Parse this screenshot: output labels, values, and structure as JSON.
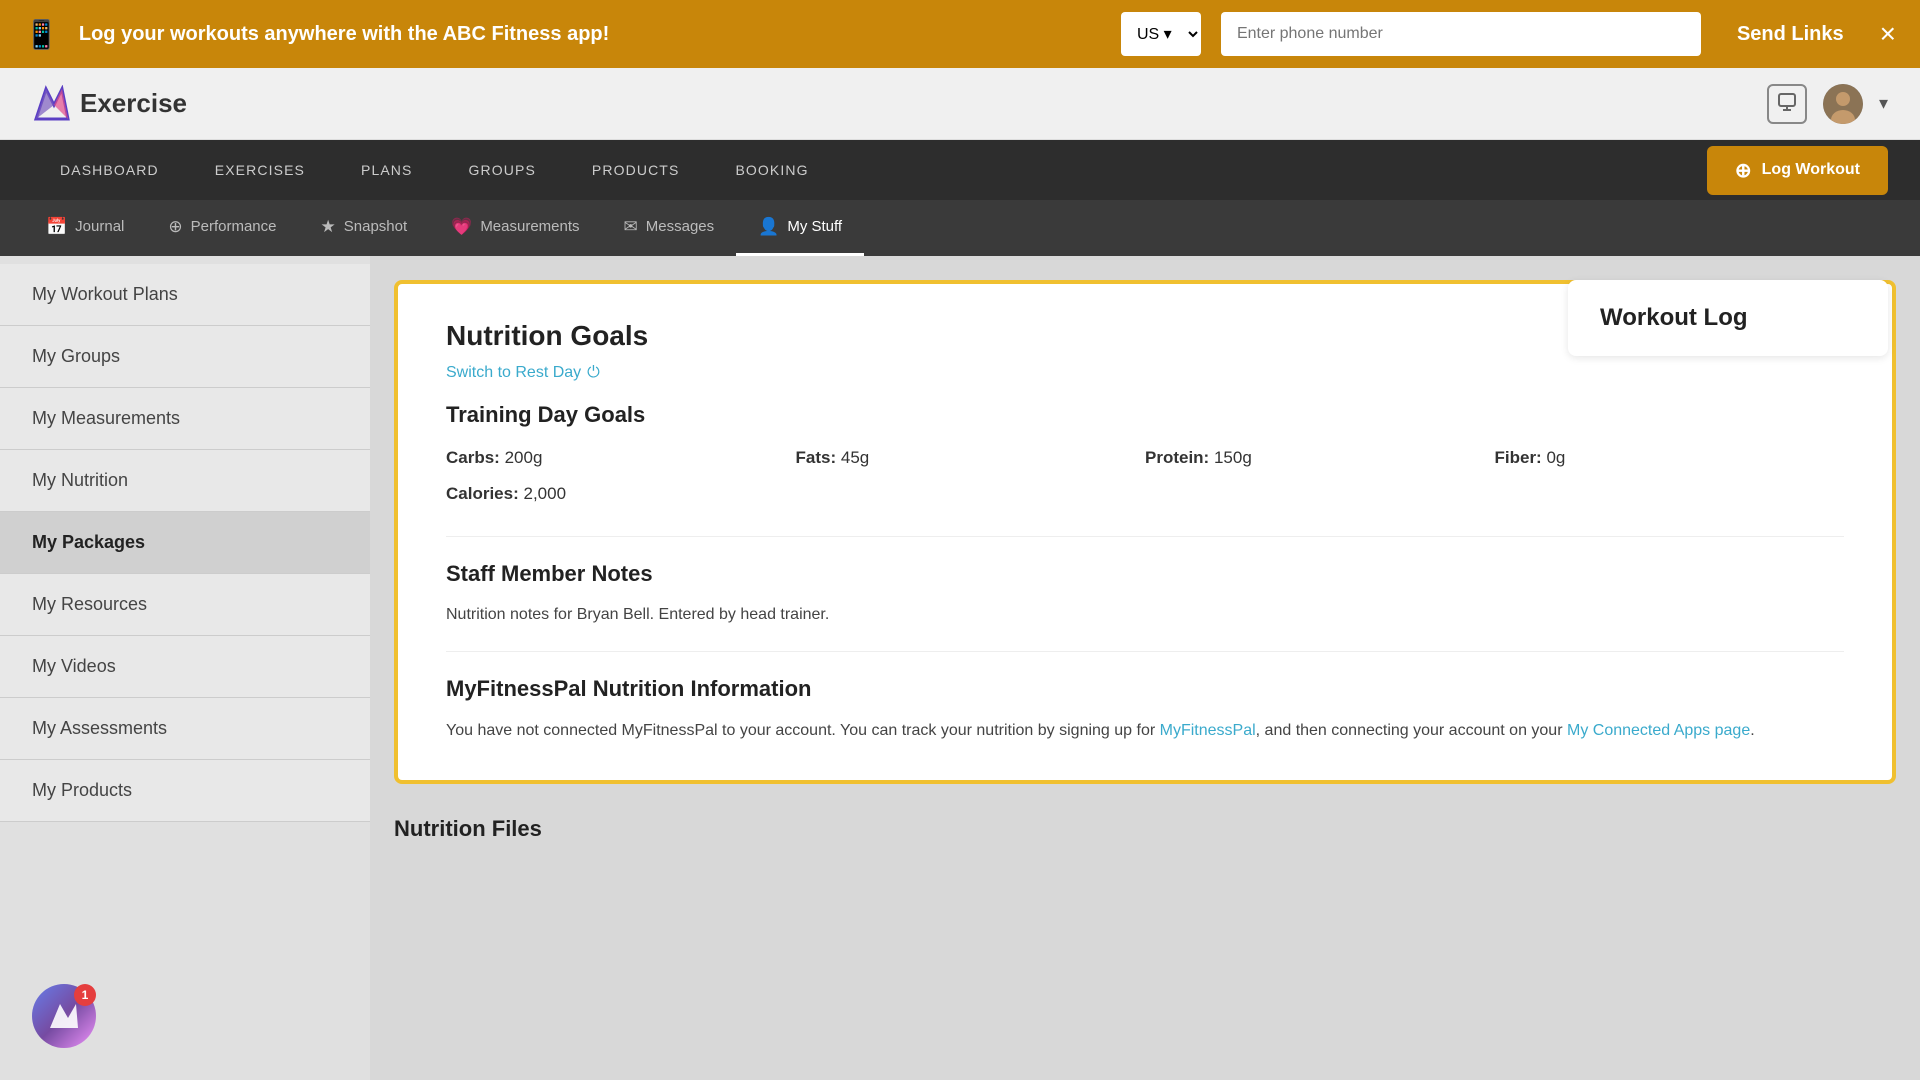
{
  "banner": {
    "text": "Log your workouts anywhere with the ABC Fitness app!",
    "country": "US",
    "phone_placeholder": "Enter phone number",
    "send_label": "Send Links",
    "close_label": "×"
  },
  "header": {
    "logo_text": "Exercise",
    "dropdown_icon": "▾"
  },
  "main_nav": {
    "items": [
      {
        "label": "DASHBOARD"
      },
      {
        "label": "EXERCISES"
      },
      {
        "label": "PLANS"
      },
      {
        "label": "GROUPS"
      },
      {
        "label": "PRODUCTS"
      },
      {
        "label": "BOOKING"
      }
    ],
    "log_workout_label": "Log Workout"
  },
  "sub_nav": {
    "items": [
      {
        "label": "Journal",
        "icon": "📅",
        "active": false
      },
      {
        "label": "Performance",
        "icon": "⊕",
        "active": false
      },
      {
        "label": "Snapshot",
        "icon": "★",
        "active": false
      },
      {
        "label": "Measurements",
        "icon": "💗",
        "active": false
      },
      {
        "label": "Messages",
        "icon": "✉",
        "active": false
      },
      {
        "label": "My Stuff",
        "icon": "👤",
        "active": true
      }
    ]
  },
  "sidebar": {
    "items": [
      {
        "label": "My Workout Plans",
        "active": false
      },
      {
        "label": "My Groups",
        "active": false
      },
      {
        "label": "My Measurements",
        "active": false
      },
      {
        "label": "My Nutrition",
        "active": false
      },
      {
        "label": "My Packages",
        "active": true
      },
      {
        "label": "My Resources",
        "active": false
      },
      {
        "label": "My Videos",
        "active": false
      },
      {
        "label": "My Assessments",
        "active": false
      },
      {
        "label": "My Products",
        "active": false
      }
    ]
  },
  "nutrition": {
    "title": "Nutrition Goals",
    "switch_rest_day": "Switch to Rest Day",
    "toggle_icon": "⏻",
    "training_day_title": "Training Day Goals",
    "carbs_label": "Carbs:",
    "carbs_value": "200g",
    "fats_label": "Fats:",
    "fats_value": "45g",
    "protein_label": "Protein:",
    "protein_value": "150g",
    "fiber_label": "Fiber:",
    "fiber_value": "0g",
    "calories_label": "Calories:",
    "calories_value": "2,000",
    "staff_notes_title": "Staff Member Notes",
    "staff_notes_text": "Nutrition notes for Bryan Bell. Entered by head trainer.",
    "mfp_title": "MyFitnessPal Nutrition Information",
    "mfp_text_before": "You have not connected MyFitnessPal to your account. You can track your nutrition by signing up for ",
    "mfp_link_text": "MyFitnessPal",
    "mfp_text_middle": ", and then connecting your account on your ",
    "mfp_connected_link": "My Connected Apps page",
    "mfp_text_after": ".",
    "files_title": "Nutrition Files"
  },
  "workout_log": {
    "title": "Workout Log"
  },
  "notification": {
    "count": "1"
  }
}
